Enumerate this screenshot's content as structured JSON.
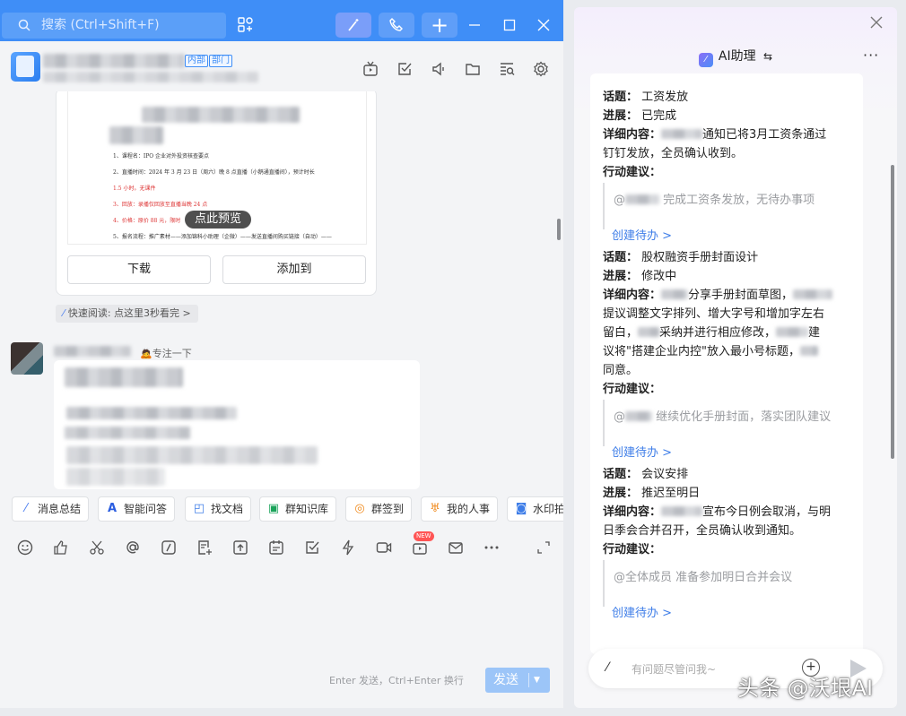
{
  "titlebar": {
    "search_placeholder": "搜索 (Ctrl+Shift+F)"
  },
  "chat_header": {
    "tags": [
      "内部",
      "部门"
    ]
  },
  "doc_card": {
    "preview_lines": [
      "1、课程名：IPO 企业对外投资核查要点",
      "2、直播时间：2024 年 3 月 23 日（周六）晚 8 点直播（小鹅通直播间），预计时长",
      "1.5 小时。无课件",
      "3、回放：录播仅回放至直播当晚 24 点",
      "4、价格：原价 88 元，限时",
      "5、报名流程：推广素材——添加锦科小助理（企微）——发送直播间购买链接（自动）——"
    ],
    "preview_label": "点此预览",
    "download_label": "下载",
    "add_to_label": "添加到",
    "quick_read": "快速阅读: 点这里3秒看完 >"
  },
  "sender": {
    "status": "🙇专注一下"
  },
  "quick_tools": [
    {
      "label": "消息总结",
      "icon": "wand-icon"
    },
    {
      "label": "智能问答",
      "icon": "ai-a-icon"
    },
    {
      "label": "找文档",
      "icon": "find-doc-icon"
    },
    {
      "label": "群知识库",
      "icon": "knowledge-base-icon"
    },
    {
      "label": "群签到",
      "icon": "check-in-icon"
    },
    {
      "label": "我的人事",
      "icon": "hr-icon"
    },
    {
      "label": "水印拍",
      "icon": "camera-icon"
    }
  ],
  "input_toolbar": {
    "new_badge": "NEW"
  },
  "composer": {
    "hint": "Enter 发送，Ctrl+Enter 换行",
    "send_label": "发送"
  },
  "ai_panel": {
    "title": "AI助理",
    "items": [
      {
        "topic_label": "话题：",
        "topic": "工资发放",
        "progress_label": "进展：",
        "progress": "已完成",
        "detail_label": "详细内容：",
        "detail_lines": [
          "通知已将3月工资条通过",
          "钉钉发放，全员确认收到。"
        ],
        "action_label": "行动建议：",
        "suggestion": "完成工资条发放，无待办事项",
        "todo": "创建待办 >"
      },
      {
        "topic_label": "话题：",
        "topic": "股权融资手册封面设计",
        "progress_label": "进展：",
        "progress": "修改中",
        "detail_label": "详细内容：",
        "detail_lines": [
          "分享手册封面草图，",
          "提议调整文字排列、增大字号和增加字左右",
          "留白，",
          "采纳并进行相应修改，",
          "建",
          "议将\"搭建企业内控\"放入最小号标题，",
          "同意。"
        ],
        "action_label": "行动建议：",
        "suggestion": "继续优化手册封面，落实团队建议",
        "todo": "创建待办 >"
      },
      {
        "topic_label": "话题：",
        "topic": "会议安排",
        "progress_label": "进展：",
        "progress": "推迟至明日",
        "detail_label": "详细内容：",
        "detail_lines": [
          "宣布今日例会取消，与明",
          "日季会合并召开，全员确认收到通知。"
        ],
        "action_label": "行动建议：",
        "suggestion": "@全体成员 准备参加明日合并会议",
        "todo": "创建待办 >"
      }
    ],
    "input_placeholder": "有问题尽管问我~"
  },
  "watermark": "头条 @沃垠AI",
  "colors": {
    "brand_blue": "#3f8ef7",
    "link_blue": "#3f7ee8",
    "send_disabled": "#9cc5f8"
  }
}
